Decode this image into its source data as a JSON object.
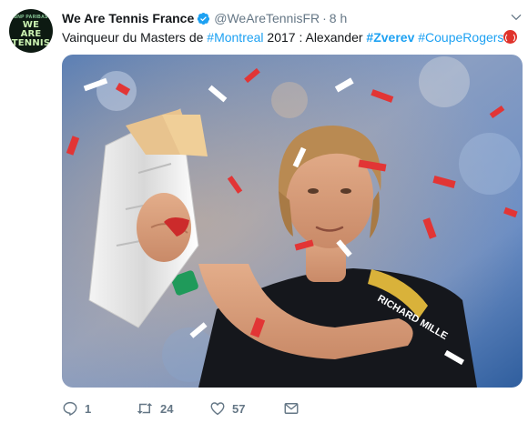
{
  "account": {
    "avatar_text": [
      "WE",
      "ARE",
      "TENNIS"
    ],
    "avatar_sponsor": "BNP PARIBAS",
    "display_name": "We Are Tennis France",
    "handle": "@WeAreTennisFR",
    "separator": "·",
    "time": "8 h"
  },
  "tweet": {
    "text_prefix": "Vainqueur du Masters de ",
    "hashtag_1": "#Montreal",
    "text_middle": " 2017 : Alexander ",
    "hashtag_2": "#Zverev",
    "text_space": " ",
    "hashtag_3": "#CoupeRogers",
    "emoji": "tennis-ball-emoji"
  },
  "photo": {
    "shirt_text": "RICHARD MILLE"
  },
  "actions": {
    "reply_count": "1",
    "retweet_count": "24",
    "like_count": "57"
  },
  "colors": {
    "link": "#1da1f2",
    "muted": "#657786",
    "verified": "#1da1f2"
  }
}
